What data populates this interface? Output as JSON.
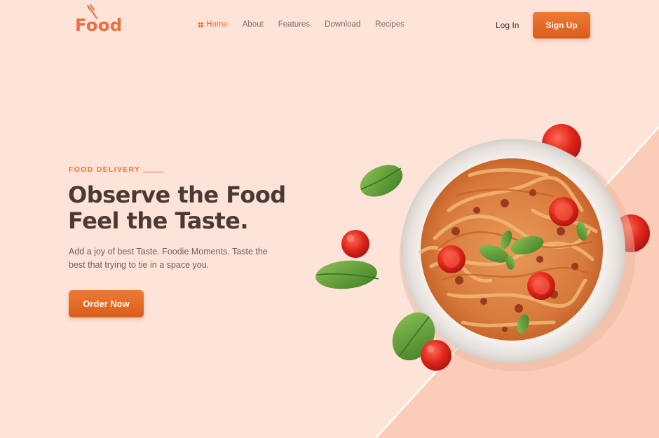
{
  "brand": {
    "logo_text": "Food"
  },
  "nav": {
    "items": [
      {
        "label": "Home",
        "active": true
      },
      {
        "label": "About"
      },
      {
        "label": "Features"
      },
      {
        "label": "Download"
      },
      {
        "label": "Recipes"
      }
    ]
  },
  "auth": {
    "login_label": "Log In",
    "signup_label": "Sign Up"
  },
  "hero": {
    "eyebrow": "FOOD DELIVERY",
    "headline_line1": "Observe the Food",
    "headline_line2": "Feel the Taste.",
    "description": "Add a joy of best Taste. Foodie Moments. Taste the best that trying to tie in a space you.",
    "cta_label": "Order Now"
  },
  "colors": {
    "background": "#fee3d9",
    "accent": "#ec6d2d",
    "accent_dark": "#d95d1c",
    "heading": "#4a3a33",
    "diagonal_panel": "#fbcdb8"
  },
  "icons": {
    "logo": "fork-icon",
    "home": "grid-icon"
  }
}
